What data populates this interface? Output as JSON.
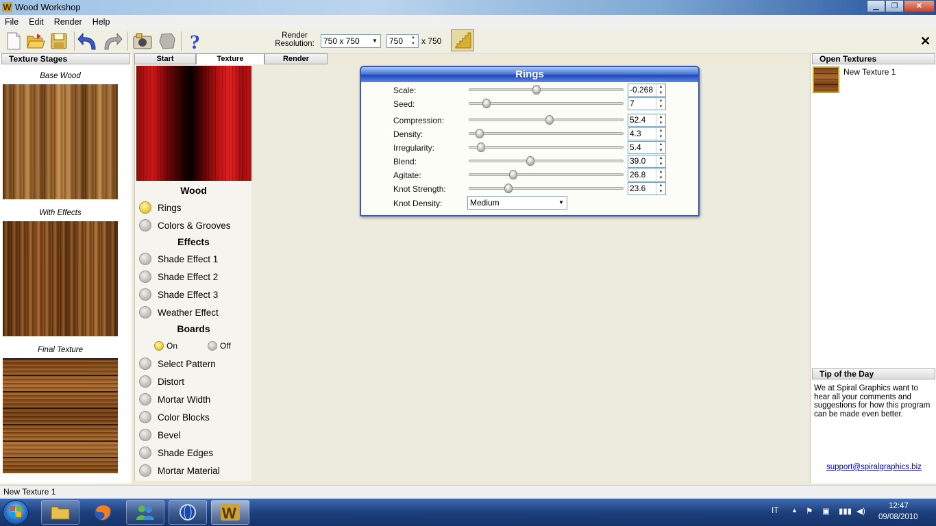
{
  "window": {
    "title": "Wood Workshop",
    "logo_letter": "W"
  },
  "menu": [
    "File",
    "Edit",
    "Render",
    "Help"
  ],
  "toolbar": {
    "icons": [
      "new-icon",
      "open-icon",
      "save-icon",
      "undo-icon",
      "redo-icon",
      "import-icon",
      "shape-icon",
      "help-icon"
    ],
    "render_resolution_label_1": "Render",
    "render_resolution_label_2": "Resolution:",
    "resolution_select": "750 x 750",
    "width_value": "750",
    "height_label": "x 750",
    "close_glyph": "✕"
  },
  "left_panel": {
    "header": "Texture Stages",
    "stages": [
      "Base Wood",
      "With Effects",
      "Final Texture"
    ]
  },
  "tabs": [
    "Start",
    "Texture",
    "Render"
  ],
  "stages_list": {
    "wood_title": "Wood",
    "wood_items": [
      "Rings",
      "Colors & Grooves"
    ],
    "effects_title": "Effects",
    "effects_items": [
      "Shade Effect 1",
      "Shade Effect 2",
      "Shade Effect 3",
      "Weather Effect"
    ],
    "boards_title": "Boards",
    "boards_on": "On",
    "boards_off": "Off",
    "boards_items": [
      "Select Pattern",
      "Distort",
      "Mortar Width",
      "Color Blocks",
      "Bevel",
      "Shade Edges",
      "Mortar Material"
    ]
  },
  "rings_panel": {
    "title": "Rings",
    "params": [
      {
        "label": "Scale:",
        "value": "-0.268",
        "level": 0.43
      },
      {
        "label": "Seed:",
        "value": "7",
        "level": 0.09
      },
      {
        "label": "Compression:",
        "value": "52.4",
        "level": 0.52
      },
      {
        "label": "Density:",
        "value": "4.3",
        "level": 0.04
      },
      {
        "label": "Irregularity:",
        "value": "5.4",
        "level": 0.05
      },
      {
        "label": "Blend:",
        "value": "39.0",
        "level": 0.39
      },
      {
        "label": "Agitate:",
        "value": "26.8",
        "level": 0.27
      },
      {
        "label": "Knot Strength:",
        "value": "23.6",
        "level": 0.24
      }
    ],
    "knot_density_label": "Knot Density:",
    "knot_density_value": "Medium"
  },
  "right_panel": {
    "open_header": "Open Textures",
    "texture_name": "New Texture 1",
    "tip_header": "Tip of the Day",
    "tip_text": "We at Spiral Graphics want to hear all your comments and suggestions for how this program can be made even better.",
    "support_link": "support@spiralgraphics.biz"
  },
  "status": {
    "text": "New Texture 1"
  },
  "taskbar": {
    "language": "IT",
    "time": "12:47",
    "date": "09/08/2010"
  }
}
